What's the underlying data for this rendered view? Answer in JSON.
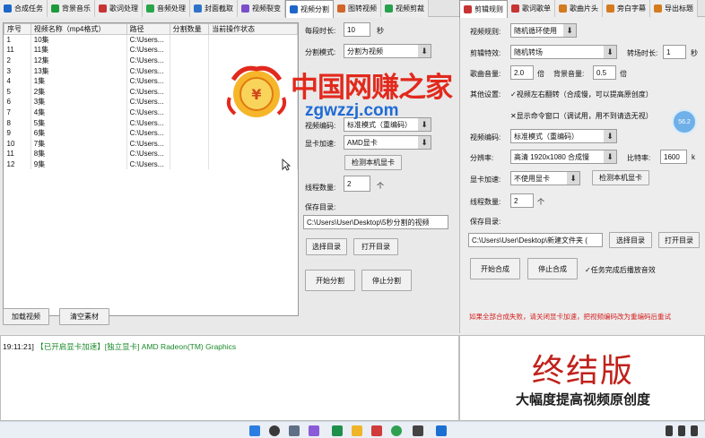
{
  "tabs_left": [
    {
      "label": "合成任务",
      "icon": "play-icon",
      "color": "#1e66c8",
      "active": false
    },
    {
      "label": "背景音乐",
      "icon": "music-icon",
      "color": "#1e9a3a",
      "active": false
    },
    {
      "label": "歌词处理",
      "icon": "lyrics-icon",
      "color": "#c73434",
      "active": false
    },
    {
      "label": "音频处理",
      "icon": "audio-icon",
      "color": "#2aa54a",
      "active": false
    },
    {
      "label": "封面截取",
      "icon": "image-icon",
      "color": "#2f73c9",
      "active": false
    },
    {
      "label": "视频裂变",
      "icon": "video-icon",
      "color": "#7b4fc8",
      "active": false
    },
    {
      "label": "视频分割",
      "icon": "play-icon",
      "color": "#1e66c8",
      "active": true
    },
    {
      "label": "图转视频",
      "icon": "film-icon",
      "color": "#d2662a",
      "active": false
    },
    {
      "label": "视频剪裁",
      "icon": "crop-icon",
      "color": "#27a14e",
      "active": false
    }
  ],
  "tabs_right": [
    {
      "label": "剪辑规则",
      "icon": "clip-icon",
      "color": "#c73434",
      "active": true
    },
    {
      "label": "歌词歌单",
      "icon": "text-icon",
      "color": "#c73434",
      "active": false
    },
    {
      "label": "歌曲片头",
      "icon": "intro-icon",
      "color": "#d47a1f",
      "active": false
    },
    {
      "label": "旁白字幕",
      "icon": "subtitle-icon",
      "color": "#d47a1f",
      "active": false
    },
    {
      "label": "导出标题",
      "icon": "export-icon",
      "color": "#d47a1f",
      "active": false
    }
  ],
  "grid": {
    "columns": [
      "序号",
      "视频名称（mp4格式）",
      "路径",
      "分割数量",
      "当前操作状态"
    ],
    "rows": [
      [
        "1",
        "10集",
        "C:\\Users...",
        "",
        ""
      ],
      [
        "11",
        "11集",
        "C:\\Users...",
        "",
        ""
      ],
      [
        "2",
        "12集",
        "C:\\Users...",
        "",
        ""
      ],
      [
        "3",
        "13集",
        "C:\\Users...",
        "",
        ""
      ],
      [
        "4",
        "1集",
        "C:\\Users...",
        "",
        ""
      ],
      [
        "5",
        "2集",
        "C:\\Users...",
        "",
        ""
      ],
      [
        "6",
        "3集",
        "C:\\Users...",
        "",
        ""
      ],
      [
        "7",
        "4集",
        "C:\\Users...",
        "",
        ""
      ],
      [
        "8",
        "5集",
        "C:\\Users...",
        "",
        ""
      ],
      [
        "9",
        "6集",
        "C:\\Users...",
        "",
        ""
      ],
      [
        "10",
        "7集",
        "C:\\Users...",
        "",
        ""
      ],
      [
        "11",
        "8集",
        "C:\\Users...",
        "",
        ""
      ],
      [
        "12",
        "9集",
        "C:\\Users...",
        "",
        ""
      ]
    ]
  },
  "left_buttons": {
    "add_video": "加载视频",
    "clear": "清空素材"
  },
  "split": {
    "segment_label": "每段时长:",
    "segment_value": "10",
    "segment_unit": "秒",
    "mode_label": "分割模式:",
    "mode_value": "分割为视频",
    "encode_label": "视频编码:",
    "encode_value": "标准模式（重编码）",
    "gpu_label": "显卡加速:",
    "gpu_value": "AMD显卡",
    "detect_button": "检测本机显卡",
    "threads_label": "线程数量:",
    "threads_value": "2",
    "threads_unit": "个",
    "save_label": "保存目录:",
    "save_path": "C:\\Users\\User\\Desktop\\5秒分割的视频",
    "choose_dir": "选择目录",
    "open_dir": "打开目录",
    "start": "开始分割",
    "stop": "停止分割"
  },
  "rules": {
    "rule_label": "视频规则:",
    "rule_value": "随机循环使用",
    "clip_label": "剪辑特效:",
    "clip_value": "随机转场",
    "clip_dur_label": "转场时长:",
    "clip_dur_value": "1",
    "clip_dur_unit": "秒",
    "song_vol_label": "歌曲音量:",
    "song_vol_value": "2.0",
    "song_vol_unit": "倍",
    "bg_vol_label": "背景音量:",
    "bg_vol_value": "0.5",
    "bg_vol_unit": "倍",
    "other_label": "其他设置:",
    "opt_mirror": "✓视频左右翻转（合成慢，可以提高原创度）",
    "opt_cmd": "✕显示命令窗口（调试用，用不到请选无视）",
    "encode_label": "视频编码:",
    "encode_value": "标准模式（重编码）",
    "res_label": "分辨率:",
    "res_value": "高清 1920x1080 合成慢",
    "bitrate_label": "比特率:",
    "bitrate_value": "1600",
    "bitrate_unit": "k",
    "gpu_label": "显卡加速:",
    "gpu_value": "不使用显卡",
    "detect_button": "检测本机显卡",
    "threads_label": "线程数量:",
    "threads_value": "2",
    "threads_unit": "个",
    "save_label": "保存目录:",
    "save_path": "C:\\Users\\User\\Desktop\\新建文件夹 (",
    "choose_dir": "选择目录",
    "open_dir": "打开目录",
    "start": "开始合成",
    "stop": "停止合成",
    "opt_sound": "✓任务完成后播放音效",
    "note": "如果全部合成失败，请关闭显卡加速，把视频编码改为重编码后重试",
    "badge": "56.2"
  },
  "log": {
    "time": "19:11:21]",
    "msg1": "【已开启显卡加速】",
    "msg2": "[独立显卡] AMD Radeon(TM) Graphics"
  },
  "promo": {
    "title": "终结版",
    "subtitle": "大幅度提高视频原创度"
  },
  "watermark": {
    "title": "中国网赚之家",
    "url": "zgwzzj.com"
  },
  "colors": {
    "accent_red": "#c0211b",
    "log_green": "#1a8a2a",
    "watermark_red": "#e2291d",
    "watermark_blue": "#1f6bd6"
  }
}
